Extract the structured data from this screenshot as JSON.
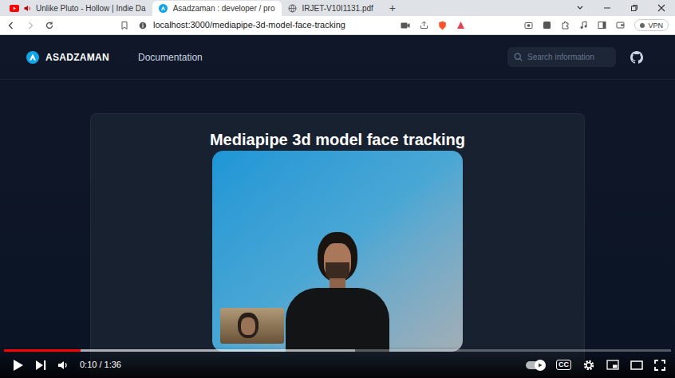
{
  "browser": {
    "tabs": [
      {
        "label": "Unlike Pluto - Hollow | Indie Da",
        "selected": false,
        "kind": "youtube"
      },
      {
        "label": "Asadzaman : developer / pro",
        "selected": true,
        "kind": "site"
      },
      {
        "label": "IRJET-V10I1131.pdf",
        "selected": false,
        "kind": "pdf"
      }
    ],
    "new_tab": "+",
    "address": "localhost:3000/mediapipe-3d-model-face-tracking",
    "vpn": "VPN"
  },
  "site": {
    "logo": "ASADZAMAN",
    "nav": [
      "Documentation"
    ],
    "search": {
      "placeholder": "Search information"
    }
  },
  "demo": {
    "title": "Mediapipe 3d model face tracking"
  },
  "player": {
    "playing": false,
    "progress": {
      "level": 0.115,
      "buffer_level": 0.526
    },
    "time": "0:10 / 1:36",
    "autoplay": true,
    "cc": "CC"
  }
}
